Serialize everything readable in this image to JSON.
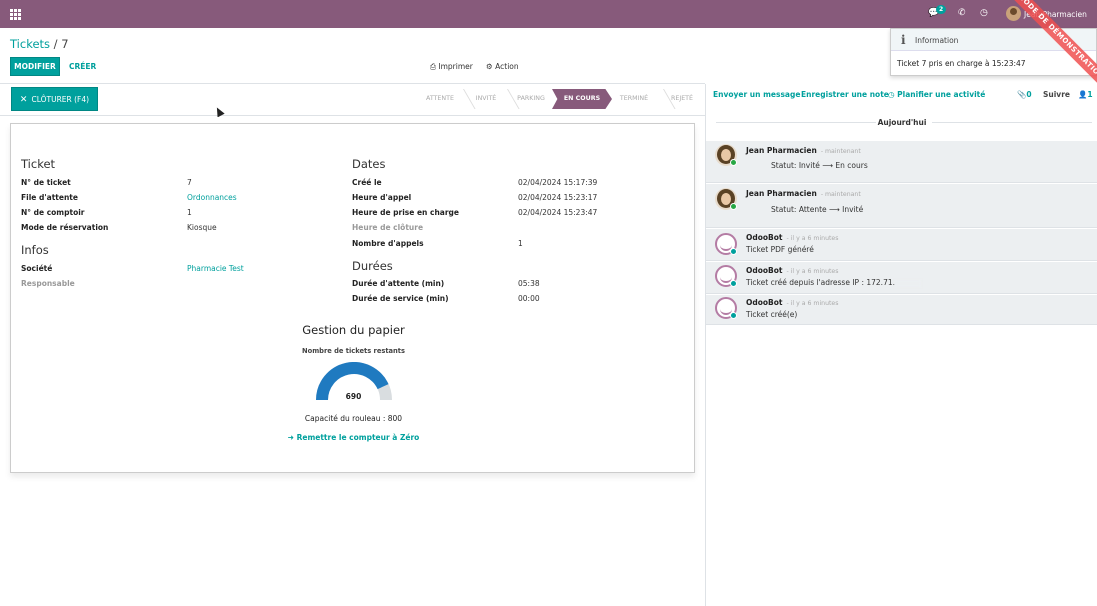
{
  "navbar": {
    "messages_badge": "2",
    "user_name": "Jean Pharmacien",
    "ribbon": "PÉRIODE DE DÉMONSTRATION"
  },
  "breadcrumb": {
    "parent": "Tickets",
    "separator": "/",
    "current": "7"
  },
  "buttons": {
    "edit": "MODIFIER",
    "create": "CRÉER",
    "print": "Imprimer",
    "action": "Action",
    "close": "CLÔTURER (F4)"
  },
  "toast": {
    "title": "Information",
    "message": "Ticket 7 pris en charge à 15:23:47"
  },
  "stages": [
    "ATTENTE",
    "INVITÉ",
    "PARKING",
    "EN COURS",
    "TERMINÉ",
    "REJETÉ"
  ],
  "active_stage": "EN COURS",
  "ticket_section": {
    "title": "Ticket",
    "fields": [
      {
        "label": "N° de ticket",
        "value": "7"
      },
      {
        "label": "File d'attente",
        "value": "Ordonnances"
      },
      {
        "label": "N° de comptoir",
        "value": "1"
      },
      {
        "label": "Mode de réservation",
        "value": "Kiosque"
      }
    ]
  },
  "infos_section": {
    "title": "Infos",
    "fields": [
      {
        "label": "Société",
        "value": "Pharmacie Test"
      },
      {
        "label": "Responsable",
        "value": ""
      }
    ]
  },
  "dates_section": {
    "title": "Dates",
    "fields": [
      {
        "label": "Créé le",
        "value": "02/04/2024 15:17:39"
      },
      {
        "label": "Heure d'appel",
        "value": "02/04/2024 15:23:17"
      },
      {
        "label": "Heure de prise en charge",
        "value": "02/04/2024 15:23:47"
      },
      {
        "label": "Heure de clôture",
        "value": ""
      },
      {
        "label": "Nombre d'appels",
        "value": "1"
      }
    ]
  },
  "durees_section": {
    "title": "Durées",
    "fields": [
      {
        "label": "Durée d'attente (min)",
        "value": "05:38"
      },
      {
        "label": "Durée de service (min)",
        "value": "00:00"
      }
    ]
  },
  "paper": {
    "title": "Gestion du papier",
    "subtitle": "Nombre de tickets restants",
    "remaining": 690,
    "remaining_label": "690",
    "capacity": 800,
    "capacity_label": "Capacité du rouleau : 800",
    "reset_label": "Remettre le compteur à Zéro",
    "colors": {
      "filled": "#1f7ac0",
      "empty": "#d9dde0"
    }
  },
  "chatter": {
    "send_message": "Envoyer un message",
    "log_note": "Enregistrer une note",
    "schedule_activity": "Planifier une activité",
    "attachments": "0",
    "follow": "Suivre",
    "followers": "1",
    "day_label": "Aujourd'hui",
    "messages": [
      {
        "author": "Jean Pharmacien",
        "time": "- maintenant",
        "body": "Statut: Invité ⟶ En cours",
        "type": "user"
      },
      {
        "author": "Jean Pharmacien",
        "time": "- maintenant",
        "body": "Statut: Attente ⟶ Invité",
        "type": "user"
      },
      {
        "author": "OdooBot",
        "time": "- il y a 6 minutes",
        "body": "Ticket PDF généré",
        "type": "bot"
      },
      {
        "author": "OdooBot",
        "time": "- il y a 6 minutes",
        "body": "Ticket créé depuis l'adresse IP : 172.71.",
        "type": "bot"
      },
      {
        "author": "OdooBot",
        "time": "- il y a 6 minutes",
        "body": "Ticket créé(e)",
        "type": "bot"
      }
    ]
  },
  "colors": {
    "brand": "#875a7b",
    "accent": "#00a09d"
  }
}
